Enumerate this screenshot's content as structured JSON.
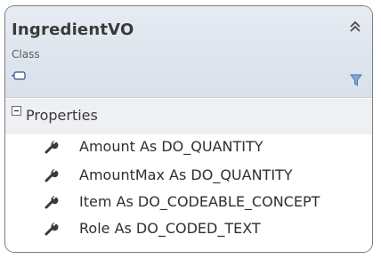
{
  "class": {
    "name": "IngredientVO",
    "stereotype": "Class"
  },
  "compartment": {
    "label": "Properties",
    "members": [
      {
        "text": "Amount As DO_QUANTITY"
      },
      {
        "text": "AmountMax As DO_QUANTITY"
      },
      {
        "text": "Item As DO_CODEABLE_CONCEPT"
      },
      {
        "text": "Role As DO_CODED_TEXT"
      }
    ]
  },
  "colors": {
    "header_bg": "#dfe5ee",
    "border": "#7d7d7d",
    "filter_icon": "#4a7ab8"
  },
  "icons": {
    "collapse": "double-chevron-up-icon",
    "class": "class-shape-icon",
    "filter": "filter-funnel-icon",
    "expander": "minus-box-icon",
    "member": "wrench-icon"
  }
}
